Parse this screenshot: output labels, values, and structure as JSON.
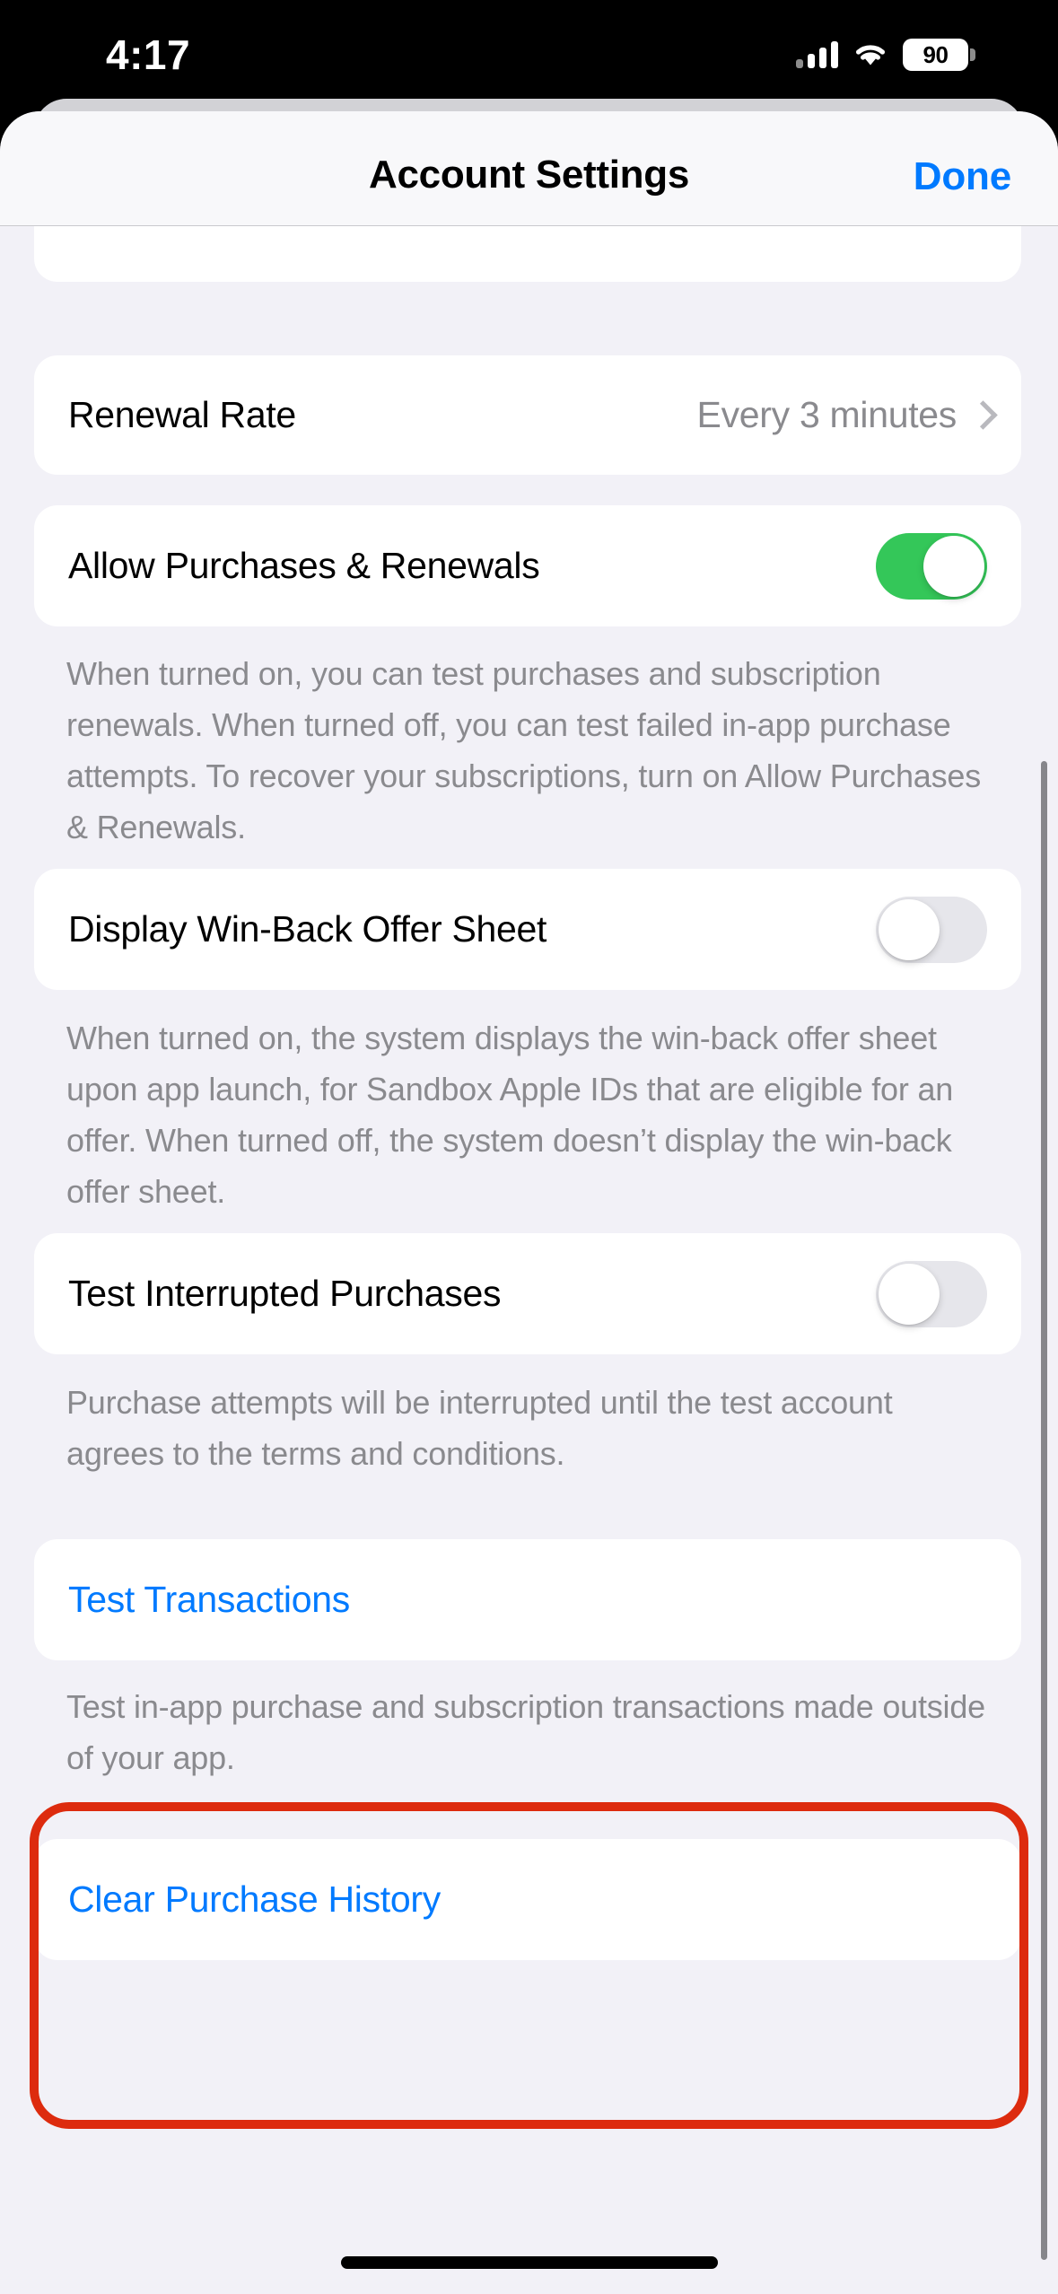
{
  "status_bar": {
    "time": "4:17",
    "battery_level": "90",
    "cellular_icon": "cellular-bars-icon",
    "wifi_icon": "wifi-icon",
    "battery_icon": "battery-icon"
  },
  "nav": {
    "title": "Account Settings",
    "done_label": "Done"
  },
  "colors": {
    "accent_blue": "#007AFF",
    "toggle_on_green": "#34C759",
    "toggle_off_gray": "#E6E6EB",
    "annotation_red": "#DD2B0E",
    "page_background": "#F2F1F7",
    "card_background": "#FFFFFF",
    "secondary_text": "#8A8A8E"
  },
  "rows": {
    "renewal_rate": {
      "label": "Renewal Rate",
      "value": "Every 3 minutes",
      "disclosure_icon": "chevron-right-icon"
    },
    "allow_purchases": {
      "label": "Allow Purchases & Renewals",
      "toggle_state": "on",
      "footnote": "When turned on, you can test purchases and subscription renewals. When turned off, you can test failed in-app purchase attempts. To recover your subscriptions, turn on Allow Purchases & Renewals."
    },
    "winback_offer": {
      "label": "Display Win-Back Offer Sheet",
      "toggle_state": "off",
      "footnote": "When turned on, the system displays the win-back offer sheet upon app launch, for Sandbox Apple IDs that are eligible for an offer. When turned off, the system doesn’t display the win-back offer sheet."
    },
    "interrupted_purchases": {
      "label": "Test Interrupted Purchases",
      "toggle_state": "off",
      "footnote": "Purchase attempts will be interrupted until the test account agrees to the terms and conditions."
    },
    "test_transactions": {
      "label": "Test Transactions",
      "footnote": "Test in-app purchase and subscription transactions made outside of your app."
    },
    "clear_purchase_history": {
      "label": "Clear Purchase History"
    }
  }
}
